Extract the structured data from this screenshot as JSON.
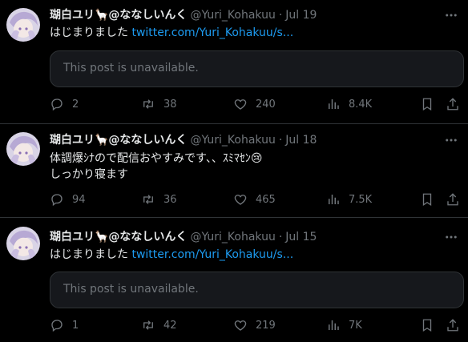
{
  "tweets": [
    {
      "name": "瑚白ユリ🦙@ななしいんく",
      "handle": "@Yuri_Kohakuu",
      "date": "Jul 19",
      "text_lines": [
        "はじまりました "
      ],
      "link": "twitter.com/Yuri_Kohakuu/s...",
      "card": "This post is unavailable.",
      "replies": "2",
      "retweets": "38",
      "likes": "240",
      "views": "8.4K"
    },
    {
      "name": "瑚白ユリ🦙@ななしいんく",
      "handle": "@Yuri_Kohakuu",
      "date": "Jul 18",
      "text_lines": [
        "体調爆ｼﾅので配信おやすみです、、ｽﾐﾏｾﾝ😢",
        "しっかり寝ます"
      ],
      "replies": "94",
      "retweets": "36",
      "likes": "465",
      "views": "7.5K"
    },
    {
      "name": "瑚白ユリ🦙@ななしいんく",
      "handle": "@Yuri_Kohakuu",
      "date": "Jul 15",
      "text_lines": [
        "はじまりました "
      ],
      "link": "twitter.com/Yuri_Kohakuu/s...",
      "card": "This post is unavailable.",
      "replies": "1",
      "retweets": "42",
      "likes": "219",
      "views": "7K"
    }
  ],
  "icons": {
    "reply": "reply-icon",
    "retweet": "retweet-icon",
    "like": "heart-icon",
    "views": "views-icon",
    "bookmark": "bookmark-icon",
    "share": "share-icon",
    "more": "more-icon"
  },
  "colors": {
    "link": "#1d9bf0",
    "muted": "#71767b",
    "text": "#e7e9ea",
    "divider": "#2f3336"
  }
}
